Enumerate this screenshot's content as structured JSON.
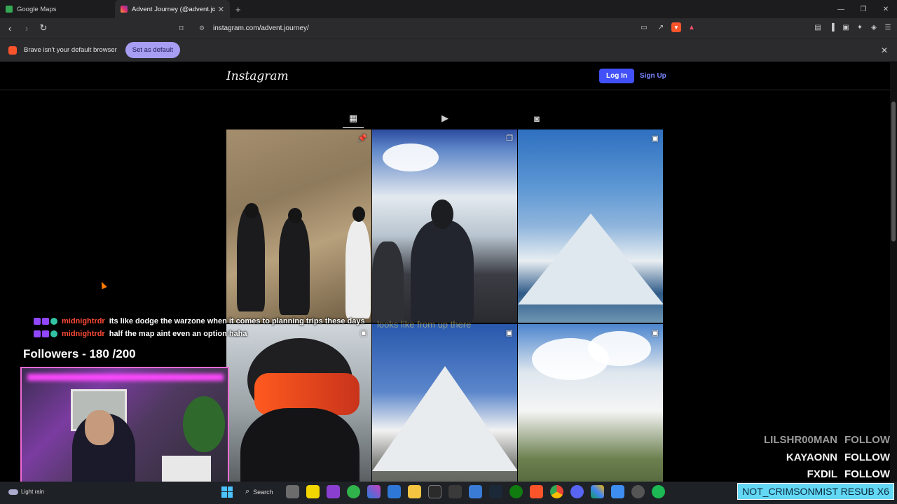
{
  "browser": {
    "tabs": [
      {
        "title": "Google Maps",
        "active": false
      },
      {
        "title": "Advent Journey (@advent.journey)",
        "active": true
      }
    ],
    "url": "instagram.com/advent.journey/",
    "infobar": {
      "message": "Brave isn't your default browser",
      "button": "Set as default"
    }
  },
  "instagram": {
    "logo": "Instagram",
    "login_label": "Log In",
    "signup_label": "Sign Up",
    "profile_tabs": [
      "grid-icon",
      "reels-icon",
      "tagged-icon"
    ],
    "posts": [
      {
        "badge": "pin-icon"
      },
      {
        "badge": "carousel-icon"
      },
      {
        "badge": "reel-icon"
      },
      {
        "badge": "reel-icon"
      },
      {
        "badge": "reel-icon",
        "caption": "looks like from up there"
      },
      {
        "badge": "reel-icon"
      }
    ]
  },
  "stream": {
    "chat": [
      {
        "user": "midnightrdr",
        "message": "its like dodge the warzone when it comes to planning trips these days"
      },
      {
        "user": "midnightrdr",
        "message": "half the map aint even an option haha"
      }
    ],
    "followers_label": "Followers - 180 /200",
    "alerts": [
      {
        "name": "LILSHR00MAN",
        "action": "FOLLOW",
        "color": "#9a9a9a"
      },
      {
        "name": "KAYAONN",
        "action": "FOLLOW",
        "color": "#f0f0f0"
      },
      {
        "name": "FXDIL",
        "action": "FOLLOW",
        "color": "#ffffff"
      }
    ],
    "sub_alert": "NOT_CRIMSONMIST  RESUB X6"
  },
  "taskbar": {
    "weather": "Light rain",
    "search_label": "Search"
  }
}
